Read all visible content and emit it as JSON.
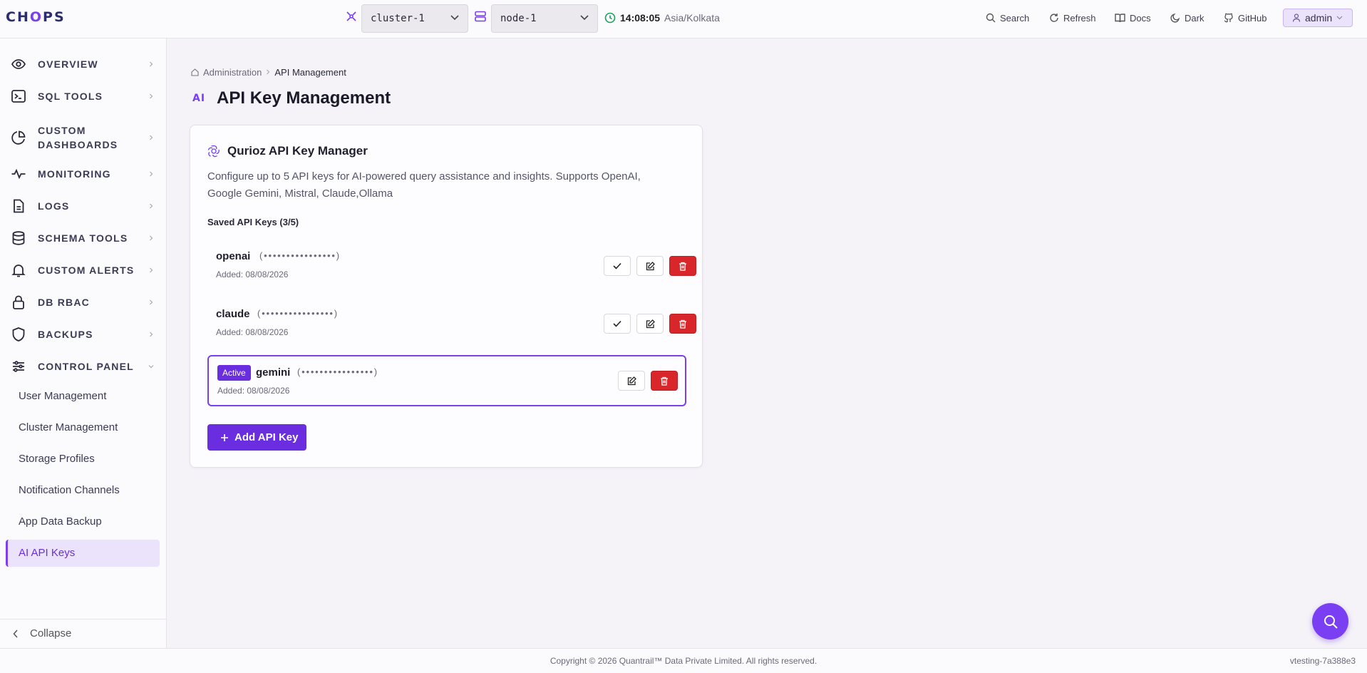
{
  "header": {
    "logo": "CHOPS",
    "cluster_select": "cluster-1",
    "node_select": "node-1",
    "clock_time": "14:08:05",
    "clock_tz": "Asia/Kolkata",
    "tools": {
      "search": "Search",
      "refresh": "Refresh",
      "docs": "Docs",
      "dark": "Dark",
      "github": "GitHub"
    },
    "user": "admin"
  },
  "sidebar": {
    "items": [
      {
        "label": "OVERVIEW",
        "icon": "eye-icon"
      },
      {
        "label": "SQL TOOLS",
        "icon": "terminal-icon"
      },
      {
        "label": "CUSTOM DASHBOARDS",
        "icon": "pie-chart-icon"
      },
      {
        "label": "MONITORING",
        "icon": "activity-icon"
      },
      {
        "label": "LOGS",
        "icon": "file-icon"
      },
      {
        "label": "SCHEMA TOOLS",
        "icon": "database-icon"
      },
      {
        "label": "CUSTOM ALERTS",
        "icon": "bell-icon"
      },
      {
        "label": "DB RBAC",
        "icon": "lock-icon"
      },
      {
        "label": "BACKUPS",
        "icon": "shield-icon"
      },
      {
        "label": "CONTROL PANEL",
        "icon": "sliders-icon"
      }
    ],
    "sub_items": [
      "User Management",
      "Cluster Management",
      "Storage Profiles",
      "Notification Channels",
      "App Data Backup",
      "AI API Keys"
    ],
    "collapse": "Collapse"
  },
  "breadcrumb": {
    "root": "Administration",
    "current": "API Management"
  },
  "page": {
    "badge": "AI",
    "title": "API Key Management"
  },
  "card": {
    "title": "Qurioz API Key Manager",
    "description": "Configure up to 5 API keys for AI-powered query assistance and insights. Supports OpenAI, Google Gemini, Mistral, Claude,Ollama",
    "saved_label": "Saved API Keys (3/5)",
    "keys": [
      {
        "name": "openai",
        "mask": "(••••••••••••••••)",
        "added": "Added: 08/08/2026",
        "active": false
      },
      {
        "name": "claude",
        "mask": "(••••••••••••••••)",
        "added": "Added: 08/08/2026",
        "active": false
      },
      {
        "name": "gemini",
        "mask": "(••••••••••••••••)",
        "added": "Added: 08/08/2026",
        "active": true,
        "badge": "Active"
      }
    ],
    "add_button": "Add API Key"
  },
  "footer": {
    "copyright": "Copyright © 2026 Quantrail™ Data Private Limited. All rights reserved.",
    "version": "vtesting-7a388e3"
  },
  "colors": {
    "accent": "#7a3ff2",
    "danger": "#d9262a"
  }
}
